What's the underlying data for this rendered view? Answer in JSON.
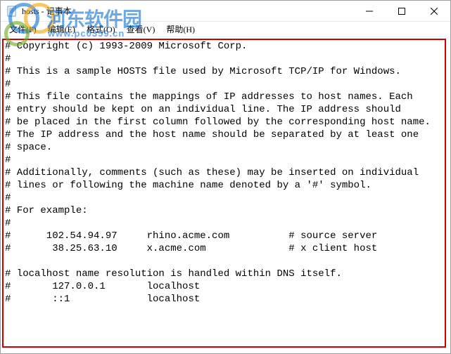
{
  "window": {
    "title": "hosts - 记事本"
  },
  "menu": {
    "file": "文件(F)",
    "edit": "编辑(E)",
    "format": "格式(O)",
    "view": "查看(V)",
    "help": "帮助(H)"
  },
  "controls": {
    "min": "—",
    "max": "☐",
    "close": "✕"
  },
  "watermark": {
    "brand": "河东软件园",
    "sub": "www.pc0359.cn"
  },
  "content": "# Copyright (c) 1993-2009 Microsoft Corp.\n#\n# This is a sample HOSTS file used by Microsoft TCP/IP for Windows.\n#\n# This file contains the mappings of IP addresses to host names. Each\n# entry should be kept on an individual line. The IP address should\n# be placed in the first column followed by the corresponding host name.\n# The IP address and the host name should be separated by at least one\n# space.\n#\n# Additionally, comments (such as these) may be inserted on individual\n# lines or following the machine name denoted by a '#' symbol.\n#\n# For example:\n#\n#      102.54.94.97     rhino.acme.com          # source server\n#       38.25.63.10     x.acme.com              # x client host\n\n# localhost name resolution is handled within DNS itself.\n#       127.0.0.1       localhost\n#       ::1             localhost"
}
